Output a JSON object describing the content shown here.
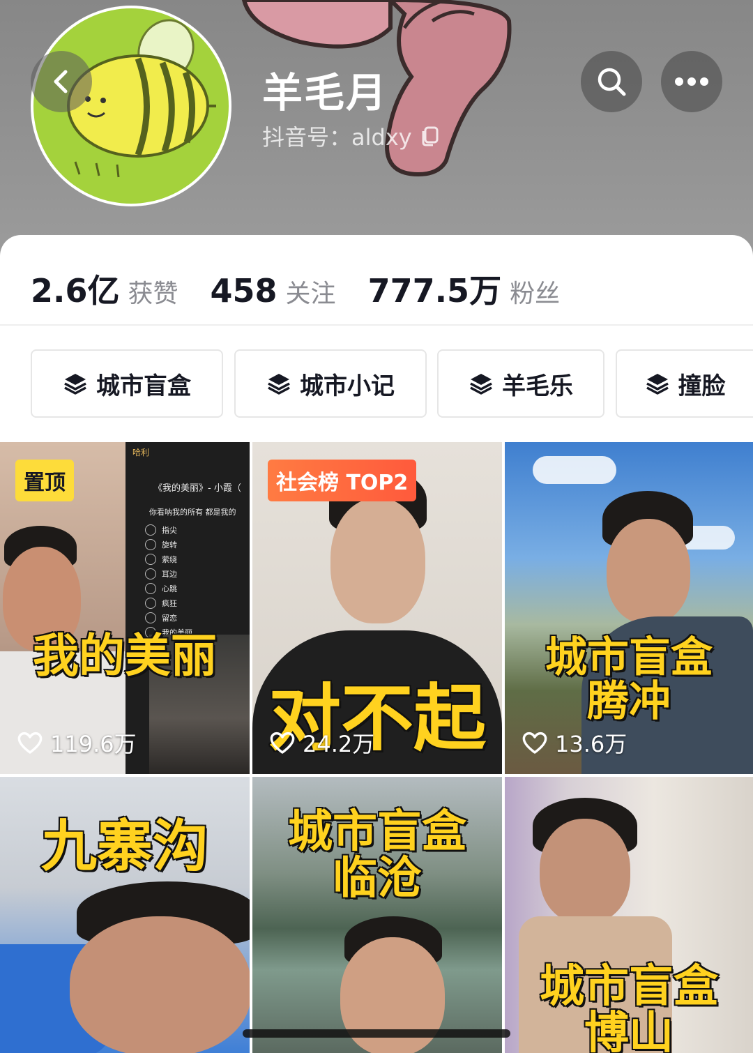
{
  "profile": {
    "name": "羊毛月",
    "douyin_id": "抖音号：aldxy"
  },
  "stats": [
    {
      "value": "2.6亿",
      "label": "获赞"
    },
    {
      "value": "458",
      "label": "关注"
    },
    {
      "value": "777.5万",
      "label": "粉丝"
    }
  ],
  "collections": [
    {
      "label": "城市盲盒",
      "icon": "layers-icon"
    },
    {
      "label": "城市小记",
      "icon": "layers-icon"
    },
    {
      "label": "羊毛乐",
      "icon": "layers-icon"
    },
    {
      "label": "撞脸",
      "icon": "layers-icon"
    }
  ],
  "videos": [
    {
      "title": "我的美丽",
      "likes": "119.6万",
      "badge": "置顶",
      "lyrics": {
        "back": "哈利",
        "song": "《我的美丽》- 小霞（",
        "line": "你看呐我的所有 都是我的",
        "items": [
          "指尖",
          "旋转",
          "萦绕",
          "耳边",
          "心跳",
          "疯狂",
          "留恋",
          "我的美丽"
        ]
      }
    },
    {
      "title": "对不起",
      "likes": "24.2万",
      "badge": "社会榜 TOP2"
    },
    {
      "title_lines": [
        "城市盲盒",
        "腾冲"
      ],
      "likes": "13.6万"
    },
    {
      "title": "九寨沟"
    },
    {
      "title_lines": [
        "城市盲盒",
        "临沧"
      ]
    },
    {
      "title_lines": [
        "城市盲盒",
        "博山"
      ]
    }
  ],
  "colors": {
    "title_yellow": "#ffd21f",
    "pinned_badge": "#fddc3a",
    "rank_badge": "#ff5a3c",
    "muted_text": "#8a8b91"
  }
}
